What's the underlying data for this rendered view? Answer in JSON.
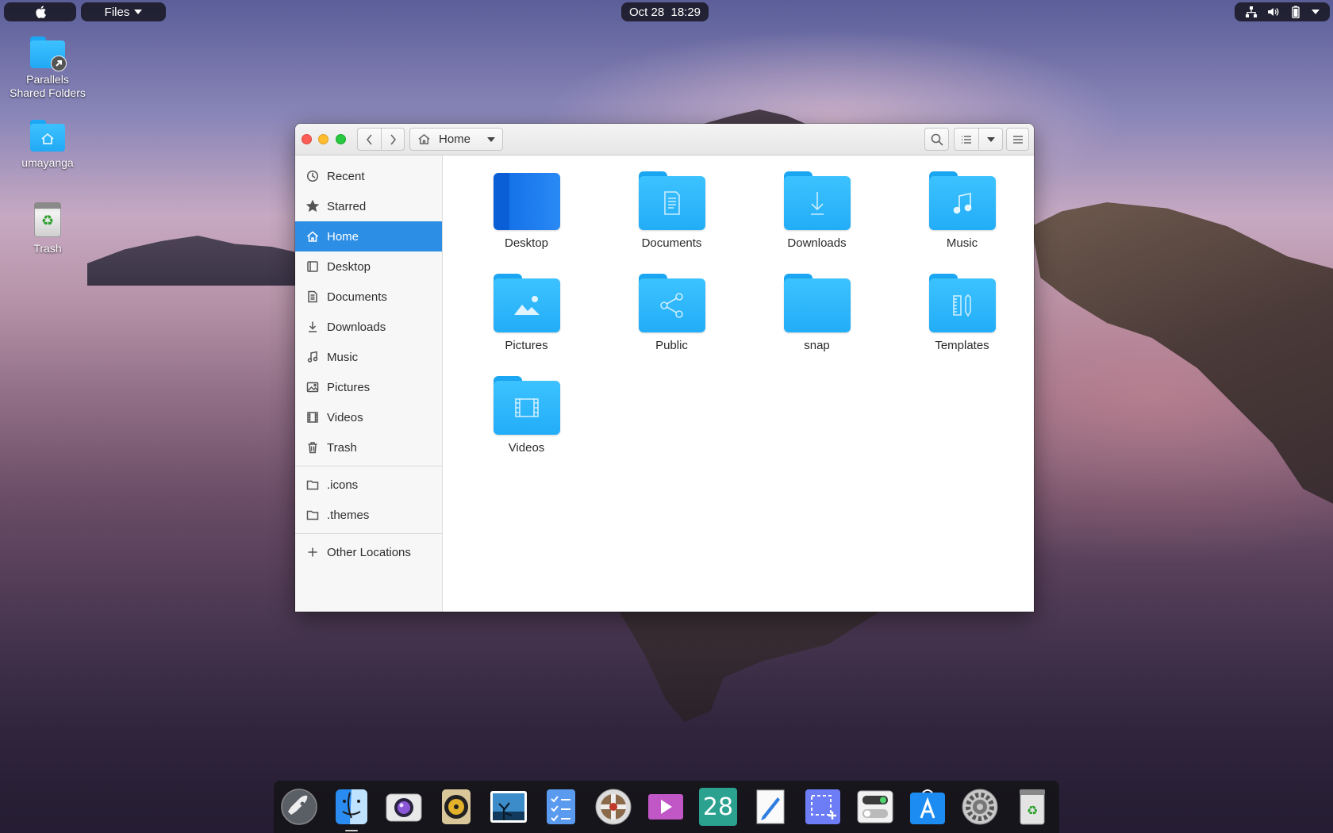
{
  "topbar": {
    "apple_menu": "apple-logo-icon",
    "app_menu_label": "Files",
    "clock": "Oct 28  18:29",
    "status_icons": [
      "network-icon",
      "volume-icon",
      "battery-icon",
      "menu-down-icon"
    ]
  },
  "desktop": {
    "icons": [
      {
        "label_line1": "Parallels",
        "label_line2": "Shared Folders",
        "icon": "shared-folder-icon"
      },
      {
        "label": "umayanga",
        "icon": "home-folder-icon"
      },
      {
        "label": "Trash",
        "icon": "trash-icon"
      }
    ]
  },
  "window": {
    "path_label": "Home",
    "sidebar": {
      "places": [
        {
          "label": "Recent",
          "icon": "clock-icon"
        },
        {
          "label": "Starred",
          "icon": "star-icon"
        },
        {
          "label": "Home",
          "icon": "home-icon",
          "active": true
        },
        {
          "label": "Desktop",
          "icon": "desktop-icon"
        },
        {
          "label": "Documents",
          "icon": "document-icon"
        },
        {
          "label": "Downloads",
          "icon": "download-icon"
        },
        {
          "label": "Music",
          "icon": "music-icon"
        },
        {
          "label": "Pictures",
          "icon": "picture-icon"
        },
        {
          "label": "Videos",
          "icon": "video-icon"
        },
        {
          "label": "Trash",
          "icon": "trash-icon"
        }
      ],
      "bookmarks": [
        {
          "label": ".icons",
          "icon": "folder-icon"
        },
        {
          "label": ".themes",
          "icon": "folder-icon"
        }
      ],
      "other": {
        "label": "Other Locations",
        "icon": "plus-icon"
      }
    },
    "folders": [
      {
        "label": "Desktop",
        "icon": "desktop-folder-icon"
      },
      {
        "label": "Documents",
        "icon": "documents-folder-icon"
      },
      {
        "label": "Downloads",
        "icon": "downloads-folder-icon"
      },
      {
        "label": "Music",
        "icon": "music-folder-icon"
      },
      {
        "label": "Pictures",
        "icon": "pictures-folder-icon"
      },
      {
        "label": "Public",
        "icon": "public-folder-icon"
      },
      {
        "label": "snap",
        "icon": "folder-icon"
      },
      {
        "label": "Templates",
        "icon": "templates-folder-icon"
      },
      {
        "label": "Videos",
        "icon": "videos-folder-icon"
      }
    ]
  },
  "dock": {
    "apps": [
      {
        "name": "launchpad-icon"
      },
      {
        "name": "files-finder-icon",
        "running": true
      },
      {
        "name": "camera-icon"
      },
      {
        "name": "music-player-icon"
      },
      {
        "name": "photos-icon"
      },
      {
        "name": "tasks-icon"
      },
      {
        "name": "help-icon"
      },
      {
        "name": "video-player-icon"
      },
      {
        "name": "calendar-icon",
        "number": "28"
      },
      {
        "name": "text-editor-icon"
      },
      {
        "name": "screenshot-icon"
      },
      {
        "name": "tweaks-icon"
      },
      {
        "name": "app-store-icon"
      },
      {
        "name": "settings-icon"
      },
      {
        "name": "dock-trash-icon"
      }
    ]
  }
}
